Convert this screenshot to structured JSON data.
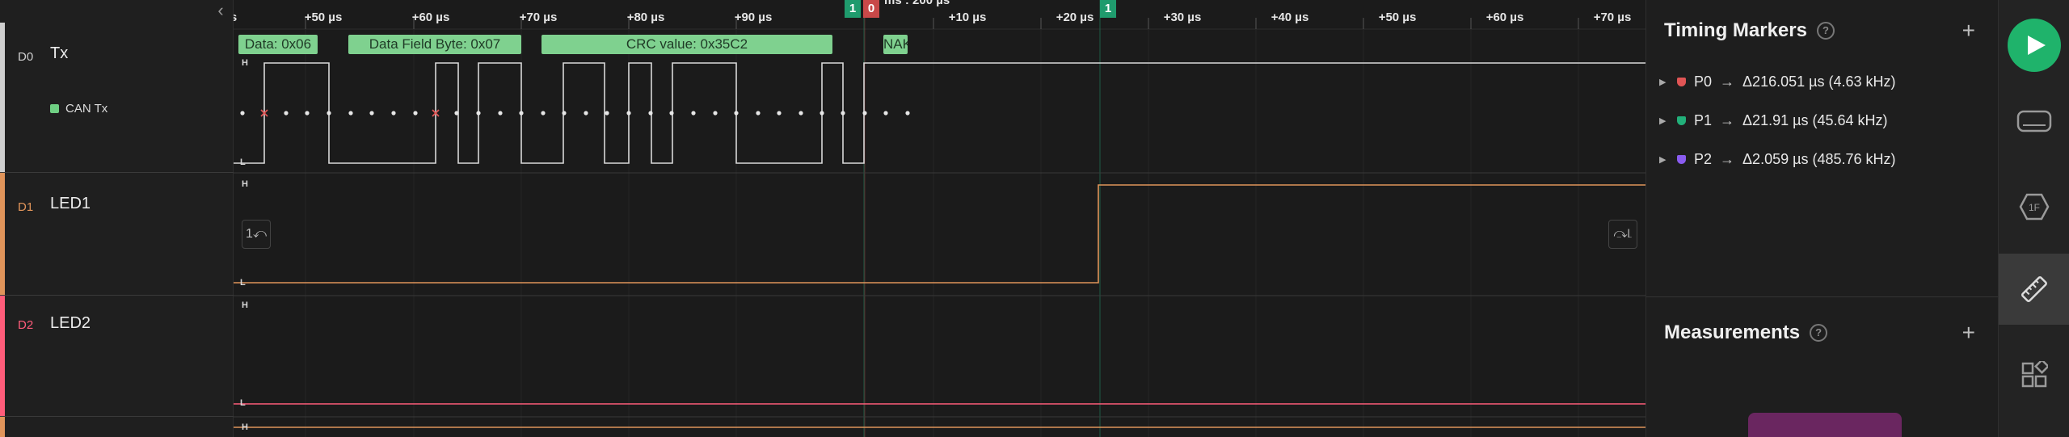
{
  "labels": {
    "collapse_icon": "‹",
    "channels": [
      {
        "id": "D0",
        "name": "Tx",
        "analyzer": "CAN Tx",
        "color": "#e6e6e6"
      },
      {
        "id": "D1",
        "name": "LED1",
        "color": "#e0945a"
      },
      {
        "id": "D2",
        "name": "LED2",
        "color": "#ff5c7a"
      }
    ]
  },
  "timeline": {
    "zoom_label": "ms : 200 µs",
    "ticks_left": [
      "+50 µs",
      "+60 µs",
      "+70 µs",
      "+80 µs",
      "+90 µs"
    ],
    "ticks_right": [
      "+10 µs",
      "+20 µs",
      "+30 µs",
      "+40 µs",
      "+50 µs",
      "+60 µs",
      "+70 µs"
    ],
    "flags": [
      {
        "label": "1",
        "color": "#1f9b6d"
      },
      {
        "label": "0",
        "color": "#c84848"
      },
      {
        "label": "1",
        "color": "#1f9b6d"
      }
    ]
  },
  "protocol": {
    "frames": [
      {
        "text": "Data: 0x06"
      },
      {
        "text": "Data Field Byte: 0x07"
      },
      {
        "text": "CRC value: 0x35C2"
      },
      {
        "text": "NAK"
      }
    ]
  },
  "levels": {
    "high": "H",
    "low": "L"
  },
  "edge_buttons": {
    "left_icon": "1⤺",
    "right_icon": "⤼⌊"
  },
  "timing_markers": {
    "title": "Timing Markers",
    "help": "?",
    "add": "+",
    "items": [
      {
        "name": "P0",
        "value": "Δ216.051 µs (4.63 kHz)",
        "color": "#e05555"
      },
      {
        "name": "P1",
        "value": "Δ21.91 µs (45.64 kHz)",
        "color": "#22b07a"
      },
      {
        "name": "P2",
        "value": "Δ2.059 µs (485.76 kHz)",
        "color": "#8a5cf0"
      }
    ]
  },
  "measurements": {
    "title": "Measurements",
    "help": "?",
    "add": "+"
  },
  "toolbar": {
    "items": [
      "play-icon",
      "device-icon",
      "analyzer-icon",
      "ruler-icon",
      "extensions-icon"
    ],
    "accent": "#1fb36b"
  }
}
